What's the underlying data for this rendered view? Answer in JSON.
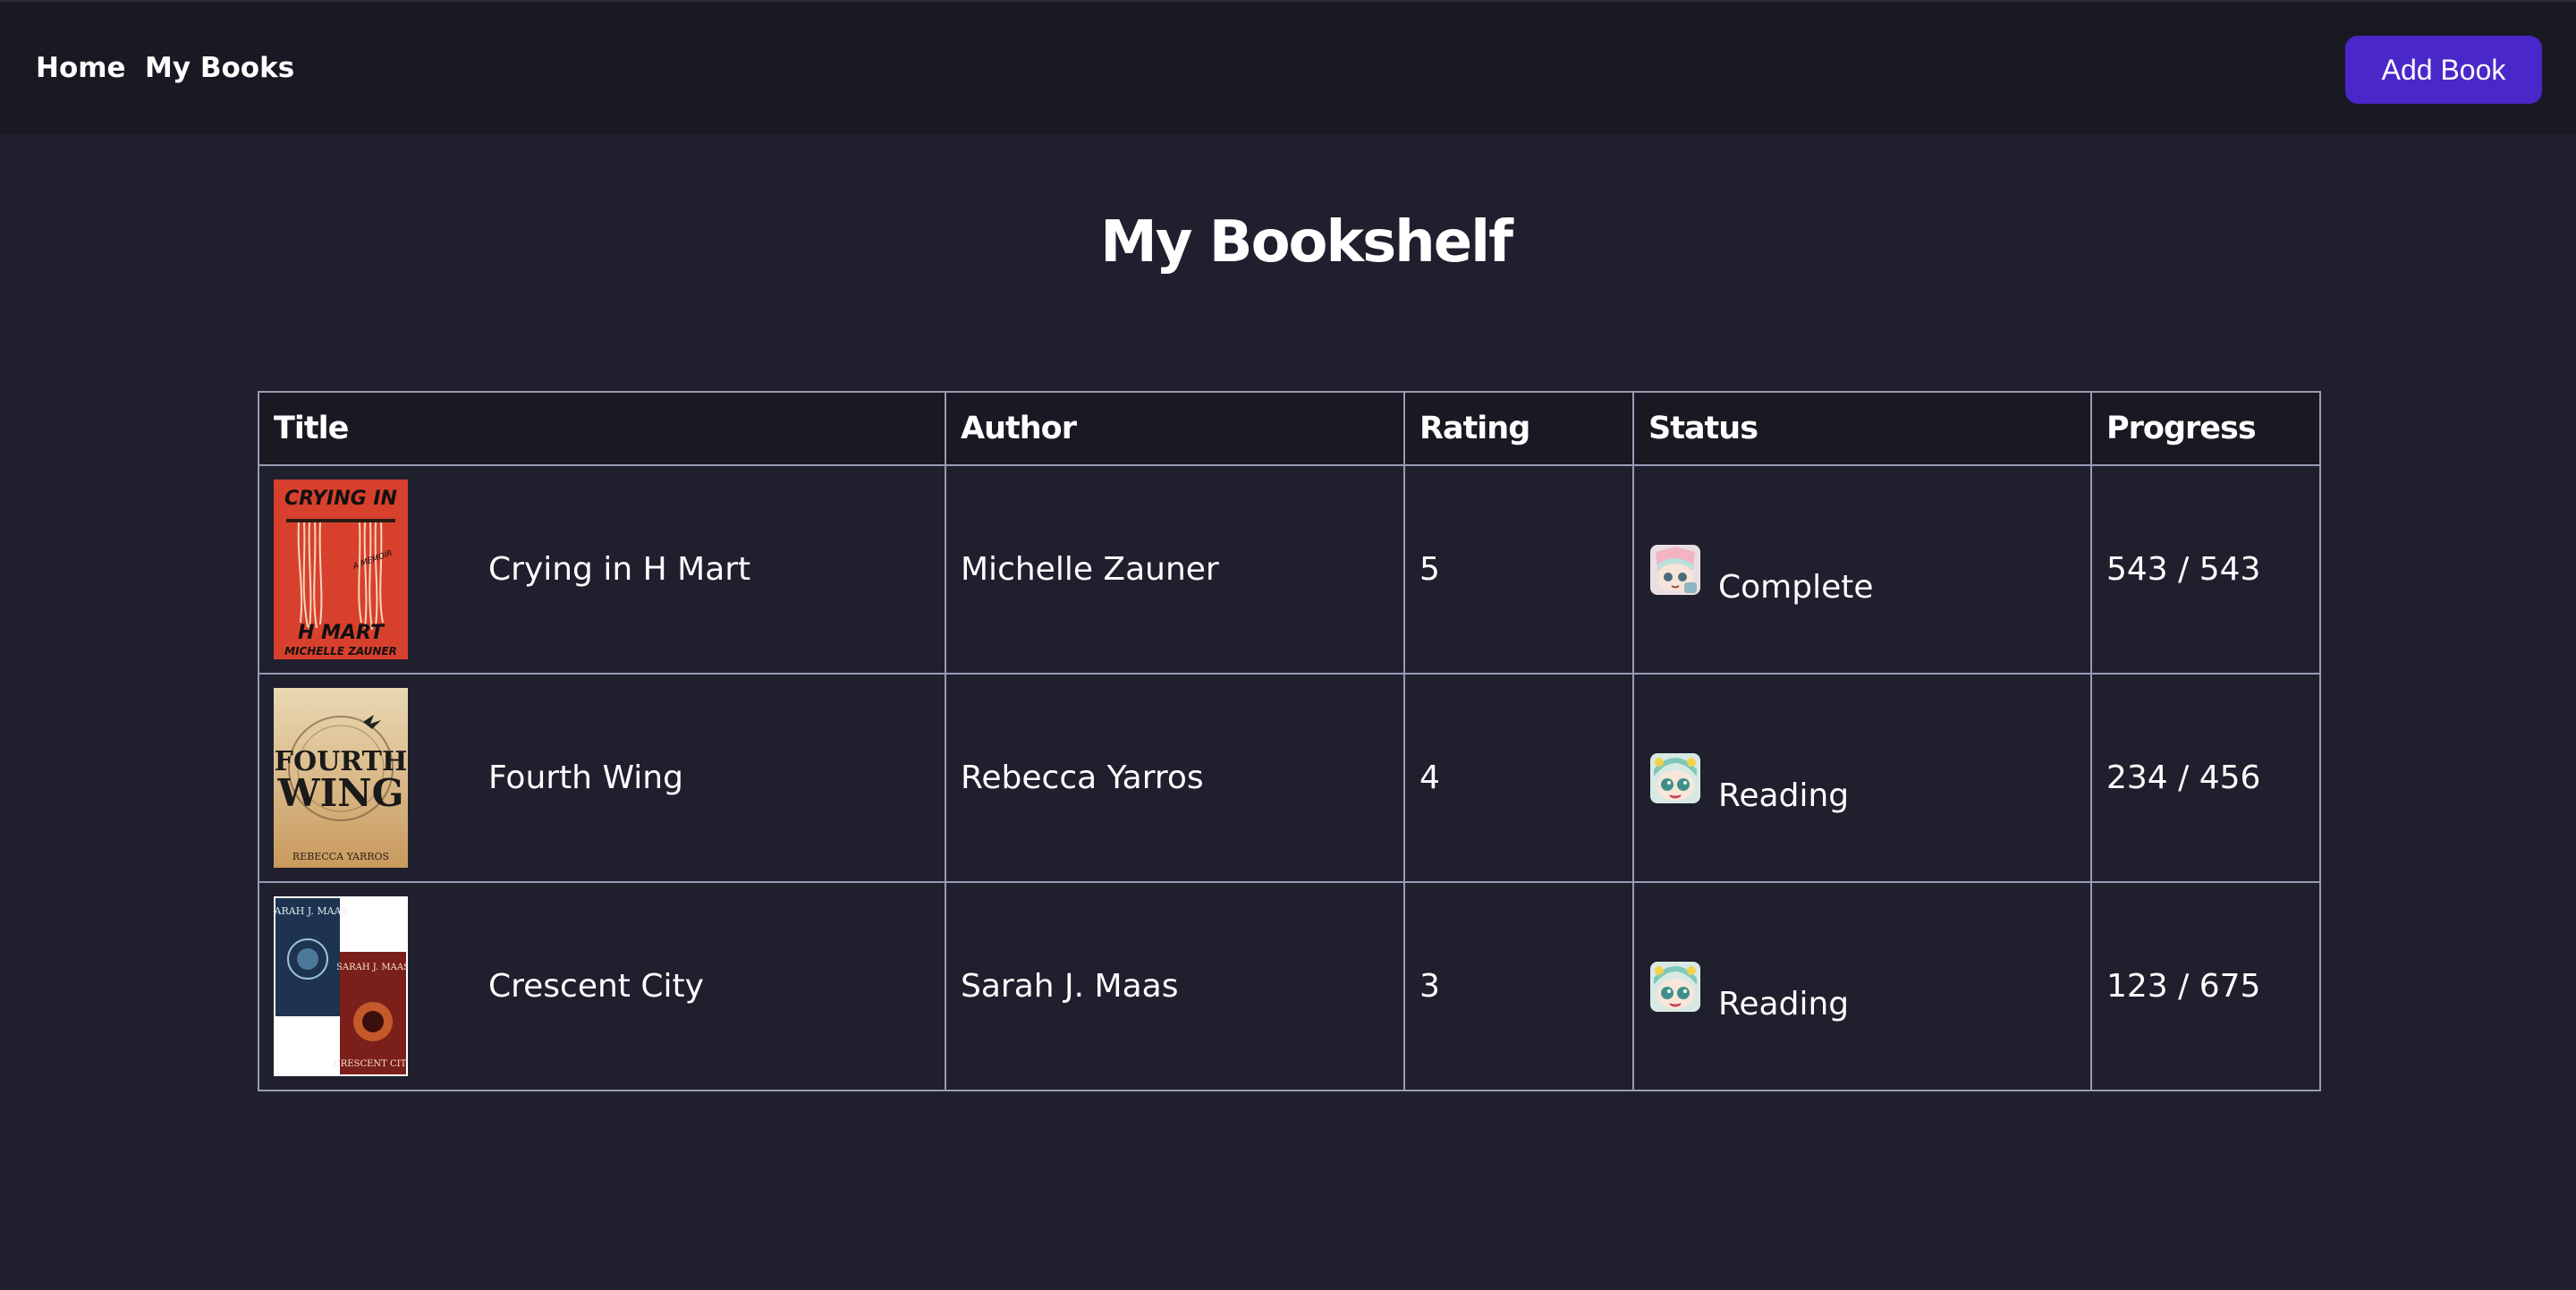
{
  "nav": {
    "links": [
      {
        "label": "Home"
      },
      {
        "label": "My Books"
      }
    ],
    "add_book_label": "Add Book",
    "accent_color": "#4a27c9"
  },
  "page": {
    "title": "My Bookshelf"
  },
  "table": {
    "headers": [
      "Title",
      "Author",
      "Rating",
      "Status",
      "Progress"
    ],
    "rows": [
      {
        "title": "Crying in H Mart",
        "author": "Michelle Zauner",
        "rating": "5",
        "status": "Complete",
        "progress": "543 / 543",
        "cover": {
          "icon": "book-cover-crying-in-h-mart",
          "lines": [
            "CRYING IN",
            "A MEMOIR",
            "H MART",
            "MICHELLE ZAUNER"
          ]
        },
        "status_icon": "complete-sticker-icon"
      },
      {
        "title": "Fourth Wing",
        "author": "Rebecca Yarros",
        "rating": "4",
        "status": "Reading",
        "progress": "234 / 456",
        "cover": {
          "icon": "book-cover-fourth-wing",
          "lines": [
            "FOURTH",
            "WING",
            "REBECCA YARROS"
          ]
        },
        "status_icon": "reading-sticker-icon"
      },
      {
        "title": "Crescent City",
        "author": "Sarah J. Maas",
        "rating": "3",
        "status": "Reading",
        "progress": "123 / 675",
        "cover": {
          "icon": "book-cover-crescent-city",
          "lines": [
            "SARAH J. MAAS",
            "SARAH J. MAAS",
            "CRESCENT CITY"
          ]
        },
        "status_icon": "reading-sticker-icon"
      }
    ]
  }
}
